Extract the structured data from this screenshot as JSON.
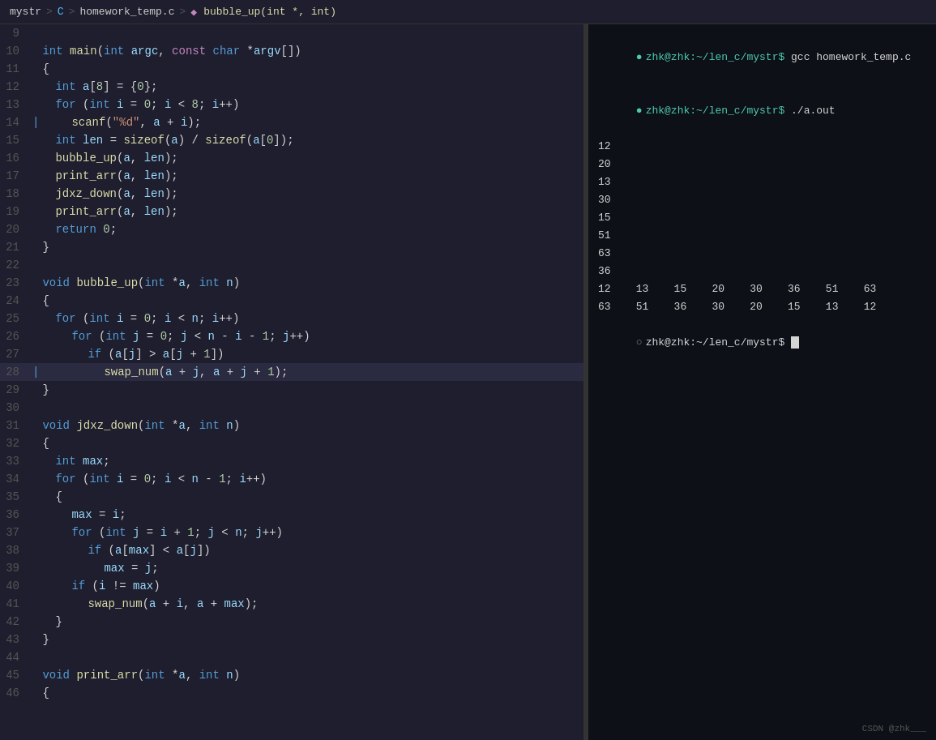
{
  "breadcrumb": {
    "items": [
      {
        "label": "mystr",
        "type": "folder"
      },
      {
        "label": "C",
        "type": "language"
      },
      {
        "label": "homework_temp.c",
        "type": "file"
      },
      {
        "label": "bubble_up(int *, int)",
        "type": "function"
      }
    ]
  },
  "editor": {
    "lines": [
      {
        "num": 9,
        "indent": 0,
        "tokens": []
      },
      {
        "num": 10,
        "indent": 0,
        "code": "<kw>int</kw> <fn>main</fn>(<kw>int</kw> <var>argc</var>, <kw2>const</kw2> <kw>char</kw> *<var>argv</var>[])"
      },
      {
        "num": 11,
        "indent": 0,
        "code": "{",
        "gutter": ""
      },
      {
        "num": 12,
        "indent": 1,
        "code": "<kw>int</kw> <var>a</var>[<num>8</num>] = {<num>0</num>};"
      },
      {
        "num": 13,
        "indent": 1,
        "code": "<kw>for</kw> (<kw>int</kw> <var>i</var> = <num>0</num>; <var>i</var> < <num>8</num>; <var>i</var>++)"
      },
      {
        "num": 14,
        "indent": 2,
        "code": "<fn>scanf</fn>(<str>\"%d\"</str>, <var>a</var> + <var>i</var>);",
        "gutter": "|"
      },
      {
        "num": 15,
        "indent": 1,
        "code": "<kw>int</kw> <var>len</var> = <fn>sizeof</fn>(<var>a</var>) / <fn>sizeof</fn>(<var>a</var>[<num>0</num>]);"
      },
      {
        "num": 16,
        "indent": 1,
        "code": "<fn>bubble_up</fn>(<var>a</var>, <var>len</var>);"
      },
      {
        "num": 17,
        "indent": 1,
        "code": "<fn>print_arr</fn>(<var>a</var>, <var>len</var>);"
      },
      {
        "num": 18,
        "indent": 1,
        "code": "<fn>jdxz_down</fn>(<var>a</var>, <var>len</var>);"
      },
      {
        "num": 19,
        "indent": 1,
        "code": "<fn>print_arr</fn>(<var>a</var>, <var>len</var>);"
      },
      {
        "num": 20,
        "indent": 1,
        "code": "<kw>return</kw> <num>0</num>;"
      },
      {
        "num": 21,
        "indent": 0,
        "code": "}"
      },
      {
        "num": 22,
        "indent": 0,
        "code": ""
      },
      {
        "num": 23,
        "indent": 0,
        "code": "<kw>void</kw> <fn>bubble_up</fn>(<kw>int</kw> *<var>a</var>, <kw>int</kw> <var>n</var>)"
      },
      {
        "num": 24,
        "indent": 0,
        "code": "{"
      },
      {
        "num": 25,
        "indent": 1,
        "code": "<kw>for</kw> (<kw>int</kw> <var>i</var> = <num>0</num>; <var>i</var> < <var>n</var>; <var>i</var>++)"
      },
      {
        "num": 26,
        "indent": 2,
        "code": "<kw>for</kw> (<kw>int</kw> <var>j</var> = <num>0</num>; <var>j</var> < <var>n</var> - <var>i</var> - <num>1</num>; <var>j</var>++)"
      },
      {
        "num": 27,
        "indent": 3,
        "code": "<kw>if</kw> (<var>a</var>[<var>j</var>] > <var>a</var>[<var>j</var> + <num>1</num>])"
      },
      {
        "num": 28,
        "indent": 4,
        "code": "<fn>swap_num</fn>(<var>a</var> + <var>j</var>, <var>a</var> + <var>j</var> + <num>1</num>);",
        "gutter": "|",
        "highlight": true
      },
      {
        "num": 29,
        "indent": 0,
        "code": "}"
      },
      {
        "num": 30,
        "indent": 0,
        "code": ""
      },
      {
        "num": 31,
        "indent": 0,
        "code": "<kw>void</kw> <fn>jdxz_down</fn>(<kw>int</kw> *<var>a</var>, <kw>int</kw> <var>n</var>)"
      },
      {
        "num": 32,
        "indent": 0,
        "code": "{"
      },
      {
        "num": 33,
        "indent": 1,
        "code": "<kw>int</kw> <var>max</var>;"
      },
      {
        "num": 34,
        "indent": 1,
        "code": "<kw>for</kw> (<kw>int</kw> <var>i</var> = <num>0</num>; <var>i</var> < <var>n</var> - <num>1</num>; <var>i</var>++)"
      },
      {
        "num": 35,
        "indent": 1,
        "code": "{",
        "gutter": ""
      },
      {
        "num": 36,
        "indent": 2,
        "code": "<var>max</var> = <var>i</var>;"
      },
      {
        "num": 37,
        "indent": 2,
        "code": "<kw>for</kw> (<kw>int</kw> <var>j</var> = <var>i</var> + <num>1</num>; <var>j</var> < <var>n</var>; <var>j</var>++)"
      },
      {
        "num": 38,
        "indent": 3,
        "code": "<kw>if</kw> (<var>a</var>[<var>max</var>] < <var>a</var>[<var>j</var>])"
      },
      {
        "num": 39,
        "indent": 4,
        "code": "<var>max</var> = <var>j</var>;"
      },
      {
        "num": 40,
        "indent": 2,
        "code": "<kw>if</kw> (<var>i</var> != <var>max</var>)"
      },
      {
        "num": 41,
        "indent": 3,
        "code": "<fn>swap_num</fn>(<var>a</var> + <var>i</var>, <var>a</var> + <var>max</var>);"
      },
      {
        "num": 42,
        "indent": 1,
        "code": "}"
      },
      {
        "num": 43,
        "indent": 0,
        "code": "}"
      },
      {
        "num": 44,
        "indent": 0,
        "code": ""
      },
      {
        "num": 45,
        "indent": 0,
        "code": "<kw>void</kw> <fn>print_arr</fn>(<kw>int</kw> *<var>a</var>, <kw>int</kw> <var>n</var>)"
      },
      {
        "num": 46,
        "indent": 0,
        "code": "{"
      }
    ]
  },
  "terminal": {
    "entries": [
      {
        "type": "cmd",
        "bullet": "green",
        "prompt": "zhk@zhk:~/len_c/mystr$",
        "cmd": " gcc homework_temp.c"
      },
      {
        "type": "cmd",
        "bullet": "green",
        "prompt": "zhk@zhk:~/len_c/mystr$",
        "cmd": " ./a.out"
      },
      {
        "type": "output",
        "text": "12"
      },
      {
        "type": "output",
        "text": "20"
      },
      {
        "type": "output",
        "text": "13"
      },
      {
        "type": "output",
        "text": "30"
      },
      {
        "type": "output",
        "text": "15"
      },
      {
        "type": "output",
        "text": "51"
      },
      {
        "type": "output",
        "text": "63"
      },
      {
        "type": "output",
        "text": "36"
      },
      {
        "type": "output",
        "text": "12    13    15    20    30    36    51    63"
      },
      {
        "type": "output",
        "text": "63    51    36    30    20    15    13    12"
      },
      {
        "type": "prompt",
        "bullet": "white",
        "prompt": "zhk@zhk:~/len_c/mystr$",
        "cursor": true
      }
    ]
  },
  "watermark": "CSDN @zhk___"
}
